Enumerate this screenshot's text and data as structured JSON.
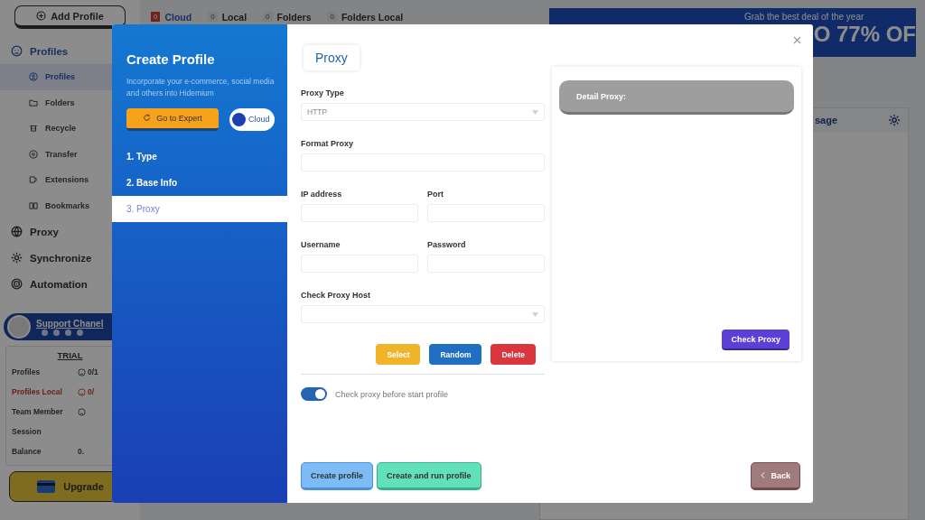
{
  "sidebar": {
    "add_button": "Add Profile",
    "sections": [
      {
        "label": "Profiles",
        "selected": true,
        "children": [
          {
            "label": "Profiles",
            "selected": true
          },
          {
            "label": "Folders",
            "selected": false
          },
          {
            "label": "Recycle",
            "selected": false
          },
          {
            "label": "Transfer",
            "selected": false
          },
          {
            "label": "Extensions",
            "selected": false
          },
          {
            "label": "Bookmarks",
            "selected": false
          }
        ]
      },
      {
        "label": "Proxy",
        "selected": false
      },
      {
        "label": "Synchronize",
        "selected": false
      },
      {
        "label": "Automation",
        "selected": false
      }
    ],
    "support": {
      "label": "Support Chanel"
    },
    "plan": {
      "title": "TRIAL",
      "rows": [
        {
          "label": "Profiles",
          "value": "0/1",
          "warning": false
        },
        {
          "label": "Profiles Local",
          "value": "0/",
          "warning": true
        },
        {
          "label": "Team Member",
          "warning": false
        },
        {
          "label": "Session",
          "warning": false
        },
        {
          "label": "Balance",
          "value": "0.",
          "warning": false
        }
      ],
      "upgrade": "Upgrade"
    }
  },
  "top_counters": [
    {
      "count": "0",
      "label": "Cloud",
      "selected": true
    },
    {
      "count": "0",
      "label": "Local",
      "selected": false
    },
    {
      "count": "0",
      "label": "Folders",
      "selected": false
    },
    {
      "count": "0",
      "label": "Folders Local",
      "selected": false
    }
  ],
  "banner": {
    "tagline": "Grab the best deal of the year",
    "headline": "O 77% OF"
  },
  "panel_header": {
    "title": "sage"
  },
  "dialog": {
    "title": "Create Profile",
    "description": "Incorporate your e-commerce, social media and others into Hidemium",
    "expert_button": "Go to Expert",
    "storage_toggle": {
      "label": "Cloud",
      "on": true
    },
    "steps": [
      {
        "label": "1. Type",
        "selected": false
      },
      {
        "label": "2. Base Info",
        "selected": false
      },
      {
        "label": "3. Proxy",
        "selected": true
      }
    ],
    "section_tab": "Proxy",
    "field_rows": [
      [
        {
          "label": "Proxy Type",
          "kind": "select",
          "value": "HTTP"
        }
      ],
      [
        {
          "label": "Format Proxy",
          "kind": "text"
        }
      ],
      [
        {
          "label": "IP address",
          "kind": "text"
        },
        {
          "label": "Port",
          "kind": "text"
        }
      ],
      [
        {
          "label": "Username",
          "kind": "text"
        },
        {
          "label": "Password",
          "kind": "text"
        }
      ],
      [
        {
          "label": "Check Proxy Host",
          "kind": "select"
        }
      ]
    ],
    "proxy_buttons": [
      {
        "label": "Select",
        "color": "#f0b429"
      },
      {
        "label": "Random",
        "color": "#1f6fc5"
      },
      {
        "label": "Delete",
        "color": "#d9363e"
      }
    ],
    "check_toggle": {
      "label": "Check proxy before start profile",
      "on": true
    },
    "detail": {
      "title": "Detail Proxy:",
      "button": "Check Proxy"
    },
    "footer_buttons": [
      {
        "label": "Create profile",
        "kind": "primary"
      },
      {
        "label": "Create and run profile",
        "kind": "success"
      },
      {
        "label": "Back",
        "kind": "back"
      }
    ]
  }
}
